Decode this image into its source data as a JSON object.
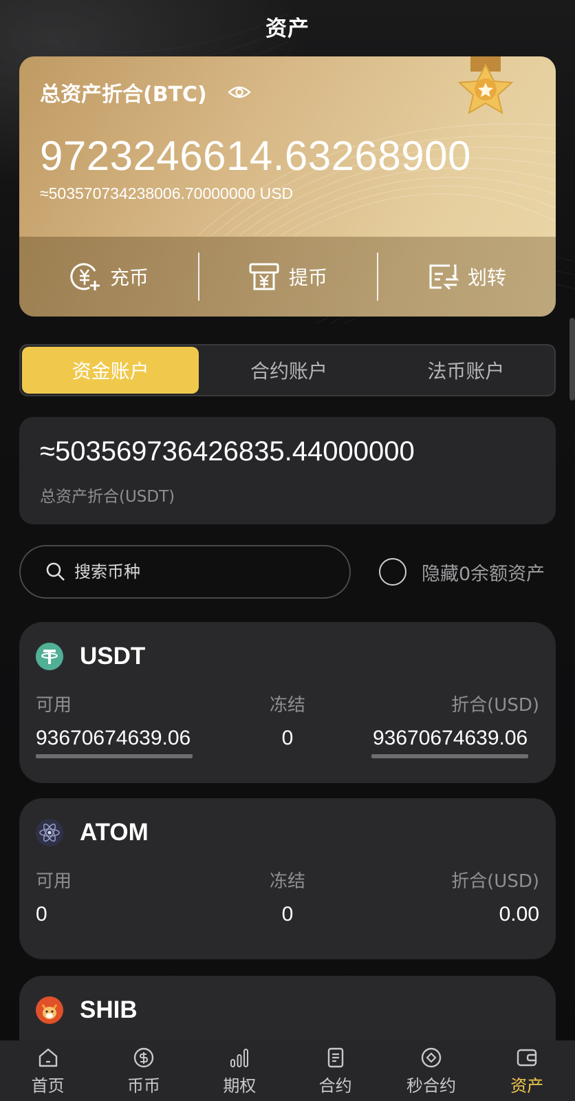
{
  "header": {
    "title": "资产"
  },
  "card": {
    "title": "总资产折合(BTC)",
    "btc_value": "9723246614.63268900",
    "usd_value": "≈503570734238006.70000000 USD",
    "actions": [
      {
        "label": "充币",
        "icon": "deposit-icon"
      },
      {
        "label": "提币",
        "icon": "withdraw-icon"
      },
      {
        "label": "划转",
        "icon": "transfer-icon"
      }
    ]
  },
  "tabs": [
    {
      "label": "资金账户",
      "active": true
    },
    {
      "label": "合约账户",
      "active": false
    },
    {
      "label": "法币账户",
      "active": false
    }
  ],
  "total": {
    "value": "≈503569736426835.44000000",
    "label": "总资产折合(USDT)"
  },
  "search": {
    "placeholder": "搜索币种",
    "value": "",
    "hide_zero_label": "隐藏0余额资产",
    "hide_zero_checked": false
  },
  "columns": {
    "available": "可用",
    "frozen": "冻结",
    "converted": "折合(USD)"
  },
  "assets": [
    {
      "name": "USDT",
      "icon": "usdt-icon",
      "available": "93670674639.06",
      "frozen": "0",
      "converted": "93670674639.06"
    },
    {
      "name": "ATOM",
      "icon": "atom-icon",
      "available": "0",
      "frozen": "0",
      "converted": "0.00"
    },
    {
      "name": "SHIB",
      "icon": "shib-icon"
    }
  ],
  "nav": [
    {
      "label": "首页",
      "icon": "home-icon",
      "active": false
    },
    {
      "label": "币币",
      "icon": "coin-icon",
      "active": false
    },
    {
      "label": "期权",
      "icon": "bar-chart-icon",
      "active": false
    },
    {
      "label": "合约",
      "icon": "document-icon",
      "active": false
    },
    {
      "label": "秒合约",
      "icon": "diamond-circle-icon",
      "active": false
    },
    {
      "label": "资产",
      "icon": "wallet-icon",
      "active": true
    }
  ],
  "colors": {
    "accent": "#f0c94c",
    "card_bg": "#29292c",
    "gold": "#d7b886"
  }
}
